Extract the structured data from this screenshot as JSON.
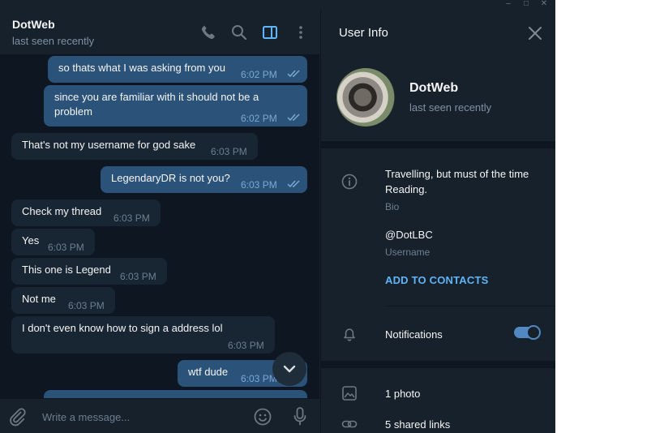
{
  "window": {
    "minimize_glyph": "–",
    "maximize_glyph": "□",
    "close_glyph": "✕"
  },
  "chat": {
    "name": "DotWeb",
    "status": "last seen recently",
    "header_icons": [
      "phone-icon",
      "search-icon",
      "sidebar-toggle-icon",
      "more-vertical-icon"
    ],
    "messages": [
      {
        "dir": "out",
        "lines": [
          "so thats what I was asking from you"
        ],
        "time": "6:02 PM",
        "read": true
      },
      {
        "dir": "out",
        "lines": [
          "since you are familiar with it should not be a",
          "problem"
        ],
        "time": "6:02 PM",
        "read": true
      },
      {
        "dir": "in",
        "lines": [
          "That's not my username for god sake"
        ],
        "time": "6:03 PM"
      },
      {
        "dir": "out",
        "lines": [
          "LegendaryDR is not you?"
        ],
        "time": "6:03 PM",
        "read": true
      },
      {
        "dir": "in",
        "lines": [
          "Check my thread"
        ],
        "time": "6:03 PM"
      },
      {
        "dir": "in",
        "lines": [
          "Yes"
        ],
        "time": "6:03 PM"
      },
      {
        "dir": "in",
        "lines": [
          "This one is Legend"
        ],
        "time": "6:03 PM"
      },
      {
        "dir": "in",
        "lines": [
          "Not me"
        ],
        "time": "6:03 PM"
      },
      {
        "dir": "in",
        "lines": [
          "I don't even know how to sign a address lol"
        ],
        "time": "6:03 PM"
      },
      {
        "dir": "out",
        "lines": [
          "wtf dude"
        ],
        "time": "6:03 PM",
        "read": false
      }
    ],
    "composer": {
      "placeholder": "Write a message...",
      "icons": [
        "paperclip-icon",
        "emoji-icon",
        "microphone-icon"
      ]
    },
    "scroll_down_icon": "chevron-down-icon"
  },
  "info": {
    "title": "User Info",
    "name": "DotWeb",
    "status": "last seen recently",
    "bio": "Travelling, but must of the time Reading.",
    "bio_label": "Bio",
    "username": "@DotLBC",
    "username_label": "Username",
    "add_contact": "ADD TO CONTACTS",
    "notifications_label": "Notifications",
    "notifications_on": true,
    "photos": "1 photo",
    "links": "5 shared links"
  },
  "colors": {
    "app_bg": "#17212b",
    "chat_bg": "#0e1621",
    "outgoing_bubble": "#2b5278",
    "incoming_bubble": "#182533",
    "accent": "#5eb5f7",
    "toggle": "#5288c1"
  }
}
